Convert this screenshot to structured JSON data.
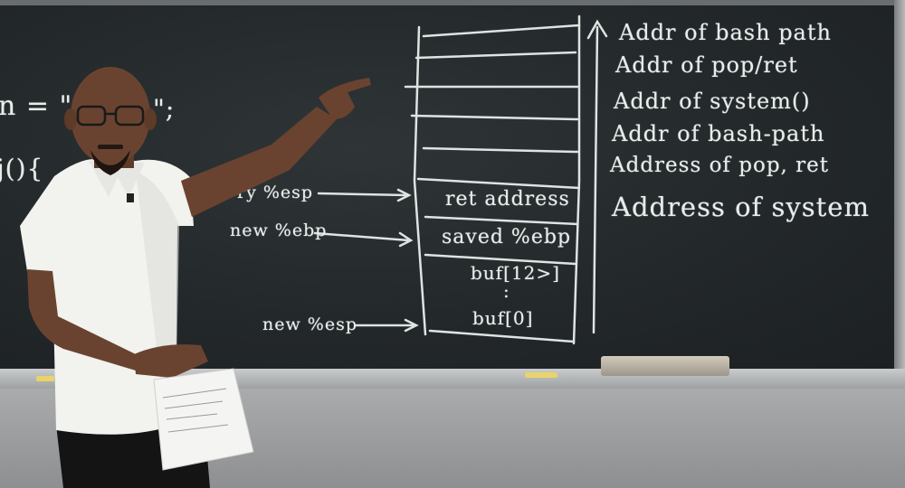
{
  "board": {
    "left_fragments": [
      {
        "text": "n = \"/ba",
        "slot": "a"
      },
      {
        "text": "h\";",
        "slot": "b"
      },
      {
        "text": "j(){",
        "slot": "c"
      },
      {
        "text": "ry %esp",
        "slot": "d"
      },
      {
        "text": "new %ebp",
        "slot": "e"
      },
      {
        "text": "new %esp",
        "slot": "f"
      }
    ],
    "stack_cells": [
      "ret address",
      "saved %ebp",
      "buf[12>]",
      ":",
      "buf[0]"
    ],
    "right_list": [
      "Addr of bash path",
      "Addr of pop/ret",
      "Addr of system()",
      "Addr of bash-path",
      "Address of pop, ret",
      "Address of system"
    ]
  },
  "colors": {
    "chalkboard": "#262b2d",
    "chalk": "#e8ecea",
    "shirt": "#f2f2ef",
    "skin": "#6a4330"
  }
}
